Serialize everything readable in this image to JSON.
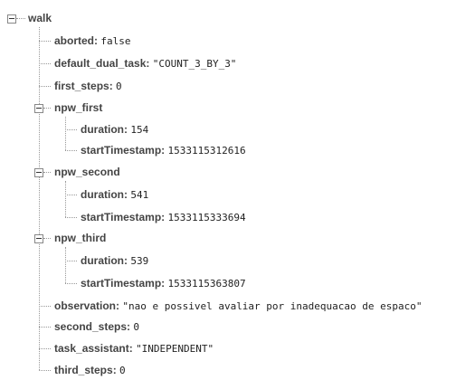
{
  "root": {
    "key": "walk"
  },
  "nodes": [
    {
      "key": "aborted",
      "sep": ":",
      "value": "false"
    },
    {
      "key": "default_dual_task",
      "sep": ":",
      "value": "\"COUNT_3_BY_3\""
    },
    {
      "key": "first_steps",
      "sep": ":",
      "value": "0"
    },
    {
      "key": "npw_first",
      "children": [
        {
          "key": "duration",
          "sep": ":",
          "value": "154"
        },
        {
          "key": "startTimestamp",
          "sep": ":",
          "value": "1533115312616"
        }
      ]
    },
    {
      "key": "npw_second",
      "children": [
        {
          "key": "duration",
          "sep": ":",
          "value": "541"
        },
        {
          "key": "startTimestamp",
          "sep": ":",
          "value": "1533115333694"
        }
      ]
    },
    {
      "key": "npw_third",
      "children": [
        {
          "key": "duration",
          "sep": ":",
          "value": "539"
        },
        {
          "key": "startTimestamp",
          "sep": ":",
          "value": "1533115363807"
        }
      ]
    },
    {
      "key": "observation",
      "sep": ":",
      "value": "\"nao e possivel avaliar por inadequacao de espaco\""
    },
    {
      "key": "second_steps",
      "sep": ":",
      "value": "0"
    },
    {
      "key": "task_assistant",
      "sep": ":",
      "value": "\"INDEPENDENT\""
    },
    {
      "key": "third_steps",
      "sep": ":",
      "value": "0"
    }
  ]
}
